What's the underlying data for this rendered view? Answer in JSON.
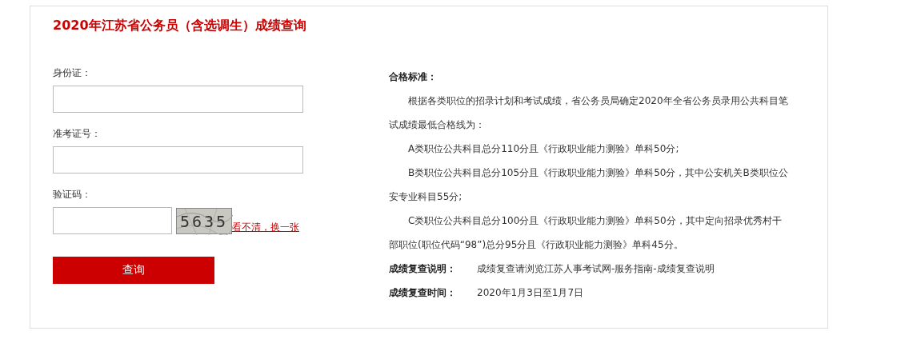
{
  "title": "2020年江苏省公务员（含选调生）成绩查询",
  "form": {
    "fields": [
      {
        "label": "身份证：",
        "kind": "text"
      },
      {
        "label": "准考证号：",
        "kind": "text"
      },
      {
        "label": "验证码：",
        "kind": "captcha",
        "captcha": "5635",
        "refresh_link": "看不清，换一张"
      }
    ],
    "submit": "查询"
  },
  "info": {
    "heading": "合格标准：",
    "paragraphs": [
      {
        "text": "根据各类职位的招录计划和考试成绩，省公务员局确定2020年全省公务员录用公共科目笔试成绩最低合格线为："
      },
      {
        "text": "A类职位公共科目总分110分且《行政职业能力测验》单科50分;"
      },
      {
        "text": "B类职位公共科目总分105分且《行政职业能力测验》单科50分，其中公安机关B类职位公安专业科目55分;"
      },
      {
        "text": "C类职位公共科目总分100分且《行政职业能力测验》单科50分，其中定向招录优秀村干部职位(职位代码“98”)总分95分且《行政职业能力测验》单科45分。"
      }
    ],
    "notes": [
      {
        "label": "成绩复查说明：",
        "value": "成绩复查请浏览江苏人事考试网-服务指南-成绩复查说明"
      },
      {
        "label": "成绩复查时间：",
        "value": "2020年1月3日至1月7日"
      }
    ]
  }
}
